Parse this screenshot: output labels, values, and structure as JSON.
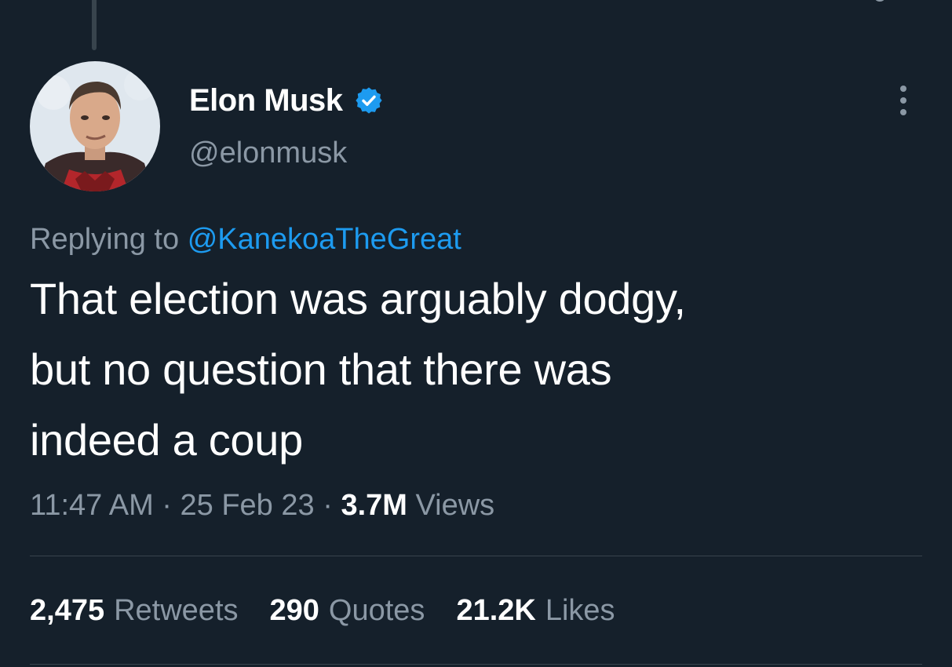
{
  "tweet": {
    "author": {
      "display_name": "Elon Musk",
      "handle": "@elonmusk",
      "verified": true,
      "verified_icon": "verified-badge-icon",
      "verified_color": "#1d9bf0"
    },
    "reply": {
      "prefix": "Replying to",
      "mention": "@KanekoaTheGreat"
    },
    "text_lines": [
      "That election was arguably dodgy,",
      "but no question that there was",
      "indeed a coup"
    ],
    "meta": {
      "time": "11:47 AM",
      "separator": "·",
      "date": "25 Feb 23",
      "views_count": "3.7M",
      "views_label": "Views"
    },
    "stats": {
      "retweets": {
        "count": "2,475",
        "label": "Retweets"
      },
      "quotes": {
        "count": "290",
        "label": "Quotes"
      },
      "likes": {
        "count": "21.2K",
        "label": "Likes"
      }
    }
  },
  "colors": {
    "background": "#15202b",
    "text_primary": "#ffffff",
    "text_secondary": "#8b98a5",
    "link": "#1d9bf0",
    "divider": "#38444d"
  }
}
